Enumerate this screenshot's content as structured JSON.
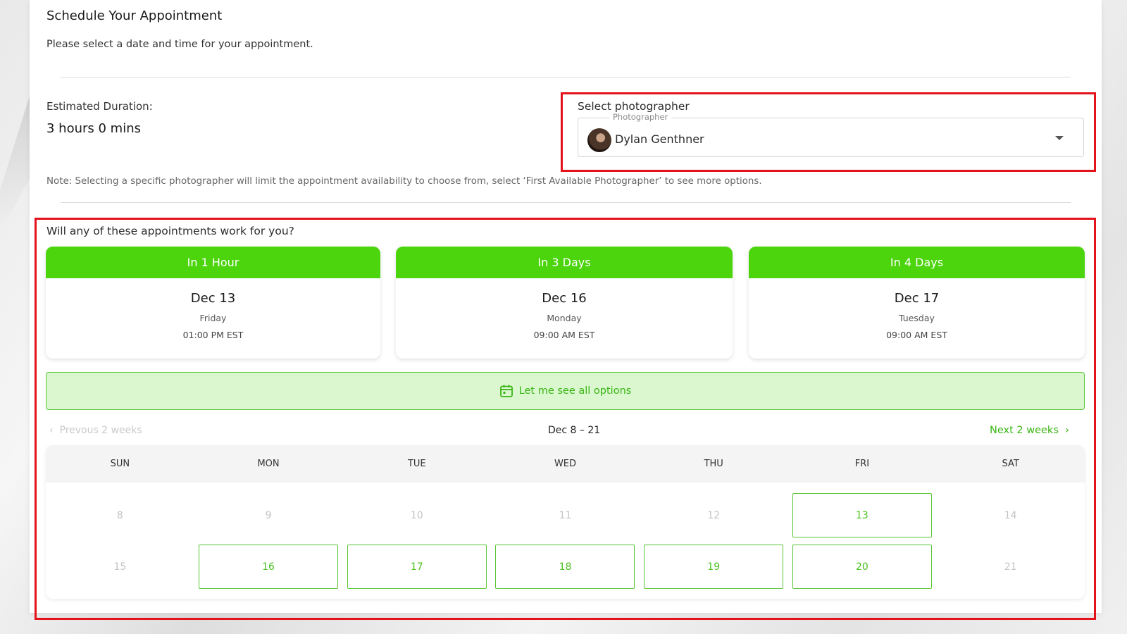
{
  "page": {
    "title": "Schedule Your Appointment",
    "subtitle": "Please select a date and time for your appointment."
  },
  "duration": {
    "label": "Estimated Duration:",
    "value": "3 hours 0 mins"
  },
  "photographer": {
    "label": "Select photographer",
    "field_legend": "Photographer",
    "selected": "Dylan Genthner",
    "icon": "chevron-down-icon"
  },
  "note": "Note: Selecting a specific photographer will limit the appointment availability to choose from, select ‘First Available Photographer’ to see more options.",
  "suggestions": {
    "question": "Will any of these appointments work for you?",
    "cards": [
      {
        "header": "In 1 Hour",
        "date": "Dec 13",
        "day": "Friday",
        "time": "01:00 PM EST"
      },
      {
        "header": "In 3 Days",
        "date": "Dec 16",
        "day": "Monday",
        "time": "09:00 AM EST"
      },
      {
        "header": "In 4 Days",
        "date": "Dec 17",
        "day": "Tuesday",
        "time": "09:00 AM EST"
      }
    ]
  },
  "see_all": {
    "label": "Let me see all options",
    "icon": "calendar-icon"
  },
  "calendar": {
    "prev_label": "Prevous 2 weeks",
    "next_label": "Next 2 weeks",
    "range": "Dec 8 – 21",
    "weekdays": [
      "SUN",
      "MON",
      "TUE",
      "WED",
      "THU",
      "FRI",
      "SAT"
    ],
    "days": [
      {
        "n": "8",
        "available": false
      },
      {
        "n": "9",
        "available": false
      },
      {
        "n": "10",
        "available": false
      },
      {
        "n": "11",
        "available": false
      },
      {
        "n": "12",
        "available": false
      },
      {
        "n": "13",
        "available": true
      },
      {
        "n": "14",
        "available": false
      },
      {
        "n": "15",
        "available": false
      },
      {
        "n": "16",
        "available": true
      },
      {
        "n": "17",
        "available": true
      },
      {
        "n": "18",
        "available": true
      },
      {
        "n": "19",
        "available": true
      },
      {
        "n": "20",
        "available": true
      },
      {
        "n": "21",
        "available": false
      }
    ]
  },
  "colors": {
    "accent": "#4cd40d",
    "highlight_border": "#e3121b",
    "available_text": "#4bc21f"
  }
}
